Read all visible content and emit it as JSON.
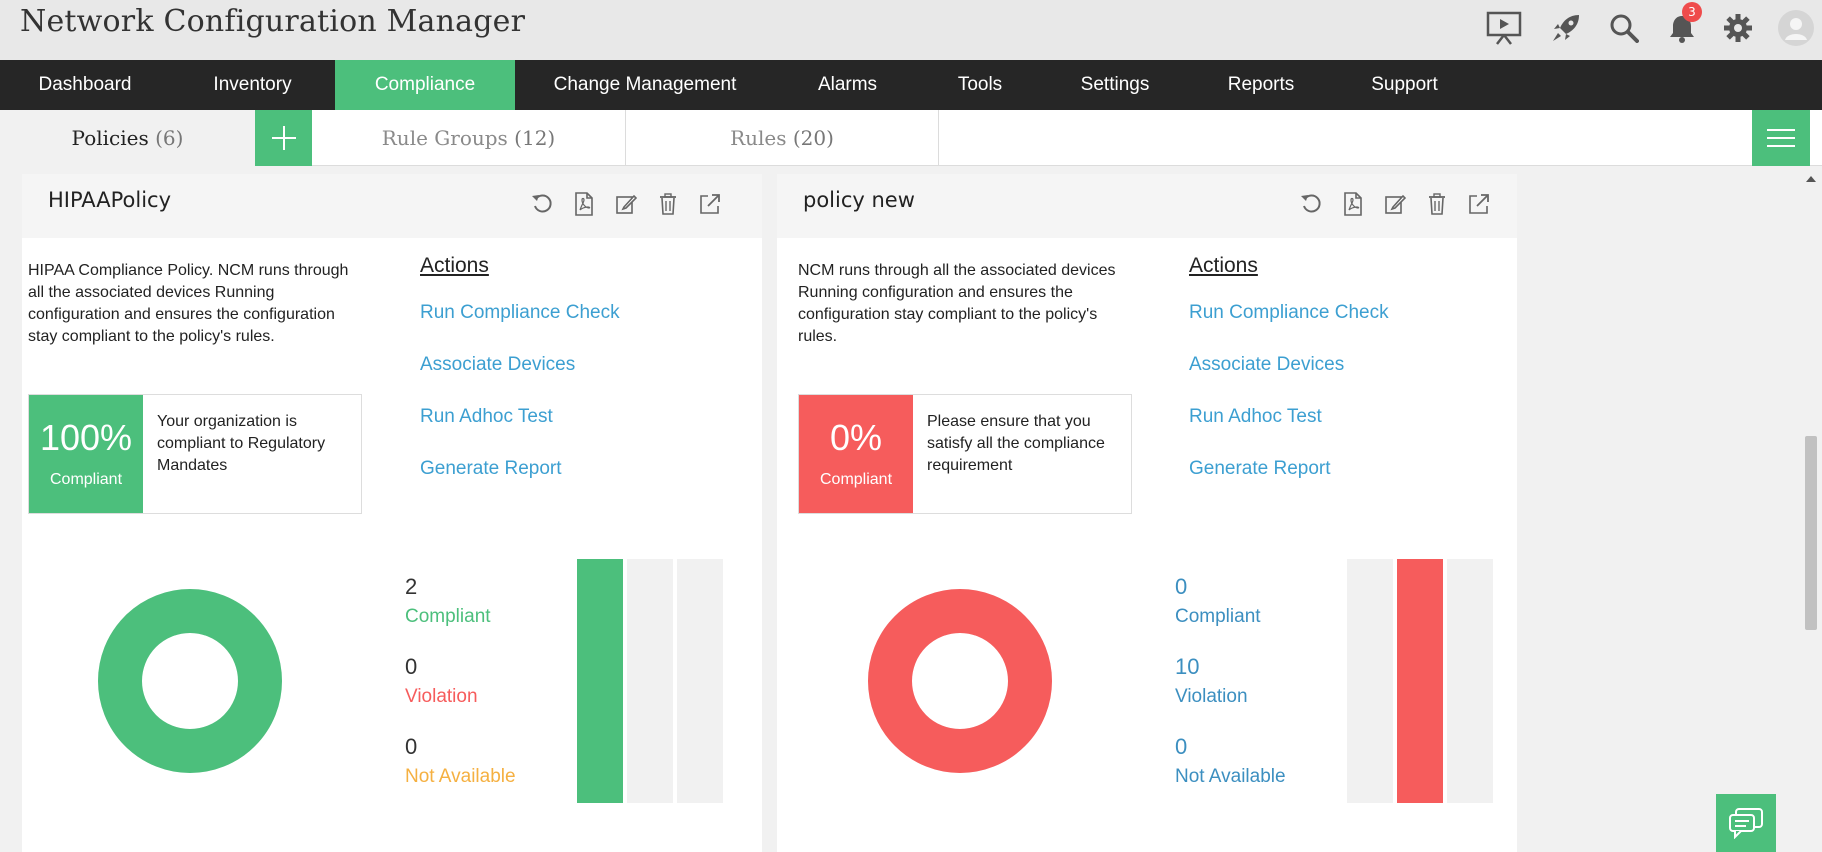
{
  "app": {
    "title": "Network Configuration Manager"
  },
  "header": {
    "icons": [
      "presentation-icon",
      "rocket-icon",
      "search-icon",
      "bell-icon",
      "gear-icon",
      "avatar-icon"
    ],
    "notification_count": "3"
  },
  "nav": {
    "items": [
      {
        "label": "Dashboard"
      },
      {
        "label": "Inventory"
      },
      {
        "label": "Compliance",
        "active": true
      },
      {
        "label": "Change Management"
      },
      {
        "label": "Alarms"
      },
      {
        "label": "Tools"
      },
      {
        "label": "Settings"
      },
      {
        "label": "Reports"
      },
      {
        "label": "Support"
      }
    ]
  },
  "subnav": {
    "tabs": [
      {
        "label": "Policies",
        "count": "(6)",
        "active": true
      },
      {
        "label": "Rule Groups",
        "count": "(12)"
      },
      {
        "label": "Rules",
        "count": "(20)"
      }
    ]
  },
  "colors": {
    "accent": "#4cbf7c",
    "danger": "#f65c5c",
    "warning": "#f5b041",
    "link": "#3c9fd1",
    "nav_bg": "#262626"
  },
  "policies": [
    {
      "title": "HIPAAPolicy",
      "description": "HIPAA Compliance Policy. NCM runs through all the associated devices Running configuration and ensures the configuration stay compliant to the policy's rules.",
      "actions_title": "Actions",
      "actions": [
        "Run Compliance Check",
        "Associate Devices",
        "Run Adhoc Test",
        "Generate Report"
      ],
      "score": {
        "percent": "100%",
        "label": "Compliant",
        "message": "Your organization is compliant to Regulatory Mandates"
      },
      "stats": [
        {
          "value": "2",
          "label": "Compliant"
        },
        {
          "value": "0",
          "label": "Violation"
        },
        {
          "value": "0",
          "label": "Not Available"
        }
      ],
      "chart_data": {
        "type": "pie",
        "categories": [
          "Compliant",
          "Violation",
          "Not Available"
        ],
        "values": [
          2,
          0,
          0
        ]
      }
    },
    {
      "title": "policy new",
      "description": "NCM runs through all the associated devices Running configuration and ensures the configuration stay compliant to the policy's rules.",
      "actions_title": "Actions",
      "actions": [
        "Run Compliance Check",
        "Associate Devices",
        "Run Adhoc Test",
        "Generate Report"
      ],
      "score": {
        "percent": "0%",
        "label": "Compliant",
        "message": "Please ensure that you satisfy all the compliance requirement"
      },
      "stats": [
        {
          "value": "0",
          "label": "Compliant"
        },
        {
          "value": "10",
          "label": "Violation"
        },
        {
          "value": "0",
          "label": "Not Available"
        }
      ],
      "chart_data": {
        "type": "pie",
        "categories": [
          "Compliant",
          "Violation",
          "Not Available"
        ],
        "values": [
          0,
          10,
          0
        ]
      }
    }
  ]
}
